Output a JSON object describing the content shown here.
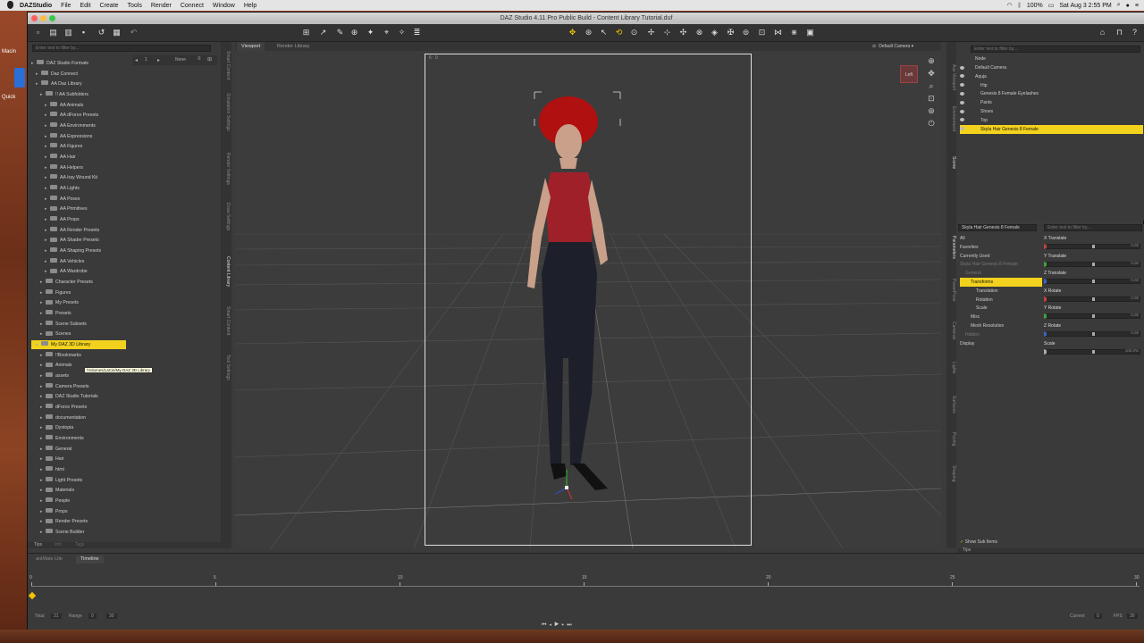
{
  "menubar": {
    "app_name": "DAZStudio",
    "items": [
      "File",
      "Edit",
      "Create",
      "Tools",
      "Render",
      "Connect",
      "Window",
      "Help"
    ],
    "battery": "100%",
    "datetime": "Sat Aug 3  2:55 PM"
  },
  "desktop": {
    "label_1": "Macin",
    "label_2": "Quick"
  },
  "window": {
    "title": "DAZ Studio 4.11 Pro Public Build - Content Library Tutorial.duf"
  },
  "content_library": {
    "filter_placeholder": "Enter text to filter by...",
    "none_label": "None",
    "selected_tooltip": "/Volumes/LaCie/My DAZ 3D Library",
    "tree": [
      {
        "label": "DAZ Studio Formats",
        "indent": 0
      },
      {
        "label": "Daz Connect",
        "indent": 1
      },
      {
        "label": "AA Daz Library",
        "indent": 1
      },
      {
        "label": "!! AA Subfolders",
        "indent": 2
      },
      {
        "label": "AA Animals",
        "indent": 3
      },
      {
        "label": "AA dForce Presets",
        "indent": 3
      },
      {
        "label": "AA Environments",
        "indent": 3
      },
      {
        "label": "AA Expressions",
        "indent": 3
      },
      {
        "label": "AA Figures",
        "indent": 3
      },
      {
        "label": "AA Hair",
        "indent": 3
      },
      {
        "label": "AA Helpers",
        "indent": 3
      },
      {
        "label": "AA Iray Wound Kit",
        "indent": 3
      },
      {
        "label": "AA Lights",
        "indent": 3
      },
      {
        "label": "AA Poses",
        "indent": 3
      },
      {
        "label": "AA Primitives",
        "indent": 3
      },
      {
        "label": "AA Props",
        "indent": 3
      },
      {
        "label": "AA Render Presets",
        "indent": 3
      },
      {
        "label": "AA Shader Presets",
        "indent": 3
      },
      {
        "label": "AA Shaping Presets",
        "indent": 3
      },
      {
        "label": "AA Vehicles",
        "indent": 3
      },
      {
        "label": "AA Wardrobe",
        "indent": 3
      },
      {
        "label": "Character Presets",
        "indent": 2
      },
      {
        "label": "Figures",
        "indent": 2
      },
      {
        "label": "My Presets",
        "indent": 2
      },
      {
        "label": "Presets",
        "indent": 2
      },
      {
        "label": "Scene Subsets",
        "indent": 2
      },
      {
        "label": "Scenes",
        "indent": 2
      },
      {
        "label": "My DAZ 3D Library",
        "indent": 1
      },
      {
        "label": "!!Bookmarks",
        "indent": 2
      },
      {
        "label": "Animals",
        "indent": 2
      },
      {
        "label": "assets",
        "indent": 2
      },
      {
        "label": "Camera Presets",
        "indent": 2
      },
      {
        "label": "DAZ Studio Tutorials",
        "indent": 2
      },
      {
        "label": "dForce Presets",
        "indent": 2
      },
      {
        "label": "documentation",
        "indent": 2
      },
      {
        "label": "Dystopia",
        "indent": 2
      },
      {
        "label": "Environments",
        "indent": 2
      },
      {
        "label": "General",
        "indent": 2
      },
      {
        "label": "Hair",
        "indent": 2
      },
      {
        "label": "html",
        "indent": 2
      },
      {
        "label": "Light Presets",
        "indent": 2
      },
      {
        "label": "Materials",
        "indent": 2
      },
      {
        "label": "People",
        "indent": 2
      },
      {
        "label": "Props",
        "indent": 2
      },
      {
        "label": "Render Presets",
        "indent": 2
      },
      {
        "label": "Scene Builder",
        "indent": 2
      }
    ],
    "bottom_tabs": [
      "Tips",
      "Info",
      "Tags"
    ]
  },
  "side_tabs_left": [
    "Smart Content",
    "Simulation Settings",
    "Render Settings",
    "Draw Settings",
    "Content Library",
    "Smart Content",
    "Tool Settings"
  ],
  "viewport": {
    "tabs": [
      "Viewport",
      "Render Library"
    ],
    "aspect_label": "6 : 9",
    "camera": "Default Camera",
    "cube_label": "Left"
  },
  "scene": {
    "filter_placeholder": "Enter text to filter by...",
    "header": "Node",
    "nodes": [
      {
        "label": "Default Camera",
        "indent": 0,
        "selected": false
      },
      {
        "label": "Aquja",
        "indent": 0,
        "selected": false
      },
      {
        "label": "Hip",
        "indent": 1,
        "selected": false
      },
      {
        "label": "Genesis 8 Female Eyelashes",
        "indent": 1,
        "selected": false
      },
      {
        "label": "Pants",
        "indent": 1,
        "selected": false
      },
      {
        "label": "Shoes",
        "indent": 1,
        "selected": false
      },
      {
        "label": "Top",
        "indent": 1,
        "selected": false
      },
      {
        "label": "Skyla Hair Genesis 8 Female",
        "indent": 1,
        "selected": true
      }
    ]
  },
  "side_tabs_right": [
    "Aux Viewport",
    "Environment",
    "Scene",
    "Parameters",
    "PowerPose",
    "Cameras",
    "Lights",
    "Surfaces",
    "Posing",
    "Shaping"
  ],
  "parameters": {
    "node_select": "Skyla Hair Genesis 8 Female",
    "filter_placeholder": "Enter text to filter by...",
    "groups": [
      {
        "label": "All",
        "indent": 0,
        "selected": false
      },
      {
        "label": "Favorites",
        "indent": 0,
        "selected": false
      },
      {
        "label": "Currently Used",
        "indent": 0,
        "selected": false
      },
      {
        "label": "Skyla Hair Genesis 8 Female",
        "indent": 0,
        "selected": false,
        "dim": true
      },
      {
        "label": "General",
        "indent": 1,
        "selected": false,
        "dim": true
      },
      {
        "label": "Transforms",
        "indent": 2,
        "selected": true
      },
      {
        "label": "Translation",
        "indent": 3,
        "selected": false
      },
      {
        "label": "Rotation",
        "indent": 3,
        "selected": false
      },
      {
        "label": "Scale",
        "indent": 3,
        "selected": false
      },
      {
        "label": "Misc",
        "indent": 2,
        "selected": false
      },
      {
        "label": "Mesh Resolution",
        "indent": 2,
        "selected": false
      },
      {
        "label": "Hidden",
        "indent": 1,
        "selected": false,
        "dim": true
      },
      {
        "label": "Display",
        "indent": 0,
        "selected": false
      }
    ],
    "sliders": [
      {
        "label": "X Translate",
        "value": "0.00",
        "color": "#c04040"
      },
      {
        "label": "Y Translate",
        "value": "0.00",
        "color": "#40a040"
      },
      {
        "label": "Z Translate",
        "value": "0.00",
        "color": "#4060c0"
      },
      {
        "label": "X Rotate",
        "value": "0.00",
        "color": "#c04040"
      },
      {
        "label": "Y Rotate",
        "value": "0.00",
        "color": "#40a040"
      },
      {
        "label": "Z Rotate",
        "value": "0.00",
        "color": "#4060c0"
      },
      {
        "label": "Scale",
        "value": "100.0%",
        "color": "#aaaaaa"
      }
    ],
    "show_sub_items": "Show Sub Items",
    "bottom_tab": "Tips"
  },
  "timeline": {
    "tabs": [
      "aniMate Lite",
      "Timeline"
    ],
    "ticks": [
      "0",
      "5",
      "10",
      "15",
      "20",
      "25",
      "30"
    ],
    "total_label": "Total",
    "total": "31",
    "range_label": "Range",
    "range_start": "0",
    "range_end": "30",
    "current_label": "Current",
    "current": "0",
    "fps_label": "FPS",
    "fps": "30"
  }
}
